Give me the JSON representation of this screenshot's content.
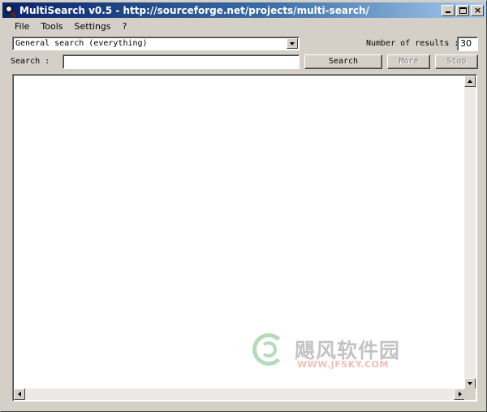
{
  "window": {
    "title": "MultiSearch v0.5 - http://sourceforge.net/projects/multi-search/",
    "icon": "magnifier-icon"
  },
  "menu": {
    "items": [
      {
        "label": "File"
      },
      {
        "label": "Tools"
      },
      {
        "label": "Settings"
      },
      {
        "label": "?"
      }
    ]
  },
  "search_type": {
    "selected": "General search (everything)"
  },
  "results_count": {
    "label": "Number of results :",
    "value": "30"
  },
  "search": {
    "label": "Search :",
    "value": ""
  },
  "buttons": {
    "search": "Search",
    "more": "More",
    "stop": "Stop"
  },
  "watermark": {
    "text": "飓风软件园",
    "url": "WWW.JFSKY.COM"
  },
  "colors": {
    "titlebar_start": "#0a246a",
    "titlebar_end": "#a6caf0",
    "face": "#d4d0c8",
    "watermark_url": "#e0452b"
  }
}
